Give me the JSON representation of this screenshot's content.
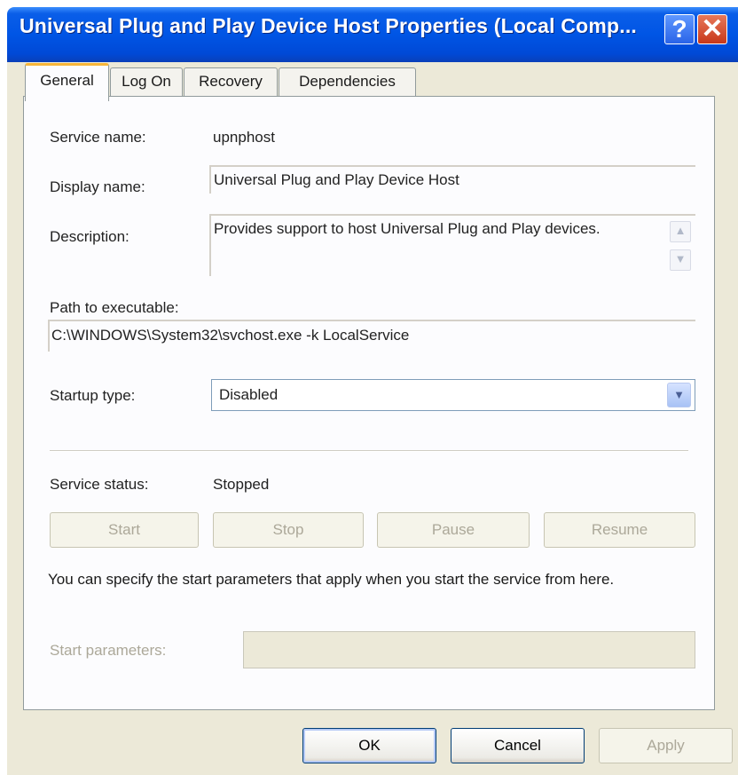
{
  "window": {
    "title": "Universal Plug and Play Device Host Properties (Local Comp...",
    "help_glyph": "?",
    "close_glyph": "✕"
  },
  "tabs": [
    {
      "label": "General",
      "active": true
    },
    {
      "label": "Log On"
    },
    {
      "label": "Recovery"
    },
    {
      "label": "Dependencies"
    }
  ],
  "general": {
    "service_name_label": "Service name:",
    "service_name_value": "upnphost",
    "display_name_label": "Display name:",
    "display_name_value": "Universal Plug and Play Device Host",
    "description_label": "Description:",
    "description_value": "Provides support to host Universal Plug and Play devices.",
    "path_label": "Path to executable:",
    "path_value": "C:\\WINDOWS\\System32\\svchost.exe -k LocalService",
    "startup_type_label": "Startup type:",
    "startup_type_value": "Disabled",
    "service_status_label": "Service status:",
    "service_status_value": "Stopped",
    "start_button": "Start",
    "stop_button": "Stop",
    "pause_button": "Pause",
    "resume_button": "Resume",
    "help_text": "You can specify the start parameters that apply when you start the service from here.",
    "start_params_label": "Start parameters:",
    "start_params_value": ""
  },
  "footer": {
    "ok": "OK",
    "cancel": "Cancel",
    "apply": "Apply"
  },
  "colors": {
    "titlebar": "#0055e5",
    "tab_highlight": "#f7b63a",
    "disabled_text": "#aca899"
  }
}
